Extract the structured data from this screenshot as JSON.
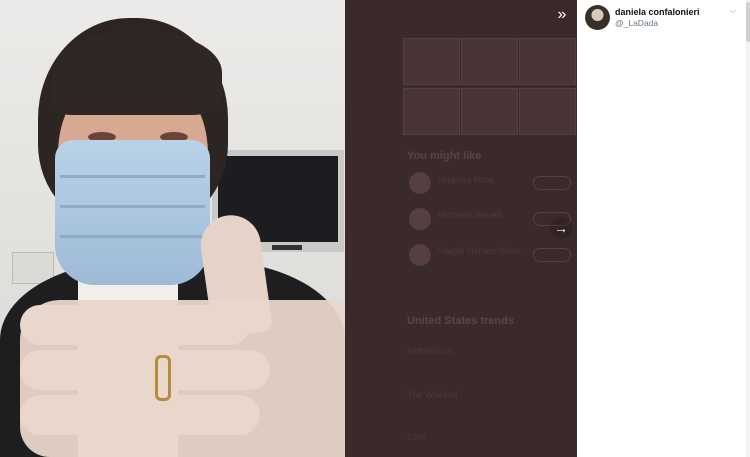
{
  "viewer": {
    "collapse_icon": "double-chevron-right-icon",
    "next_icon": "arrow-right-icon"
  },
  "background_page": {
    "you_might_like": "You might like",
    "suggestions": [
      {
        "name": "Vanessa Rota"
      },
      {
        "name": "Michaela Benelli"
      },
      {
        "name": "Fragile Heroes Show"
      }
    ],
    "trends_title": "United States trends",
    "trends": [
      {
        "label": "#afterhours"
      },
      {
        "label": "The Weeknd"
      },
      {
        "label": "Cost"
      }
    ]
  },
  "tweet": {
    "author_name": "daniela confalonieri",
    "author_handle": "@_LaDada",
    "menu_icon": "chevron-down-icon"
  }
}
